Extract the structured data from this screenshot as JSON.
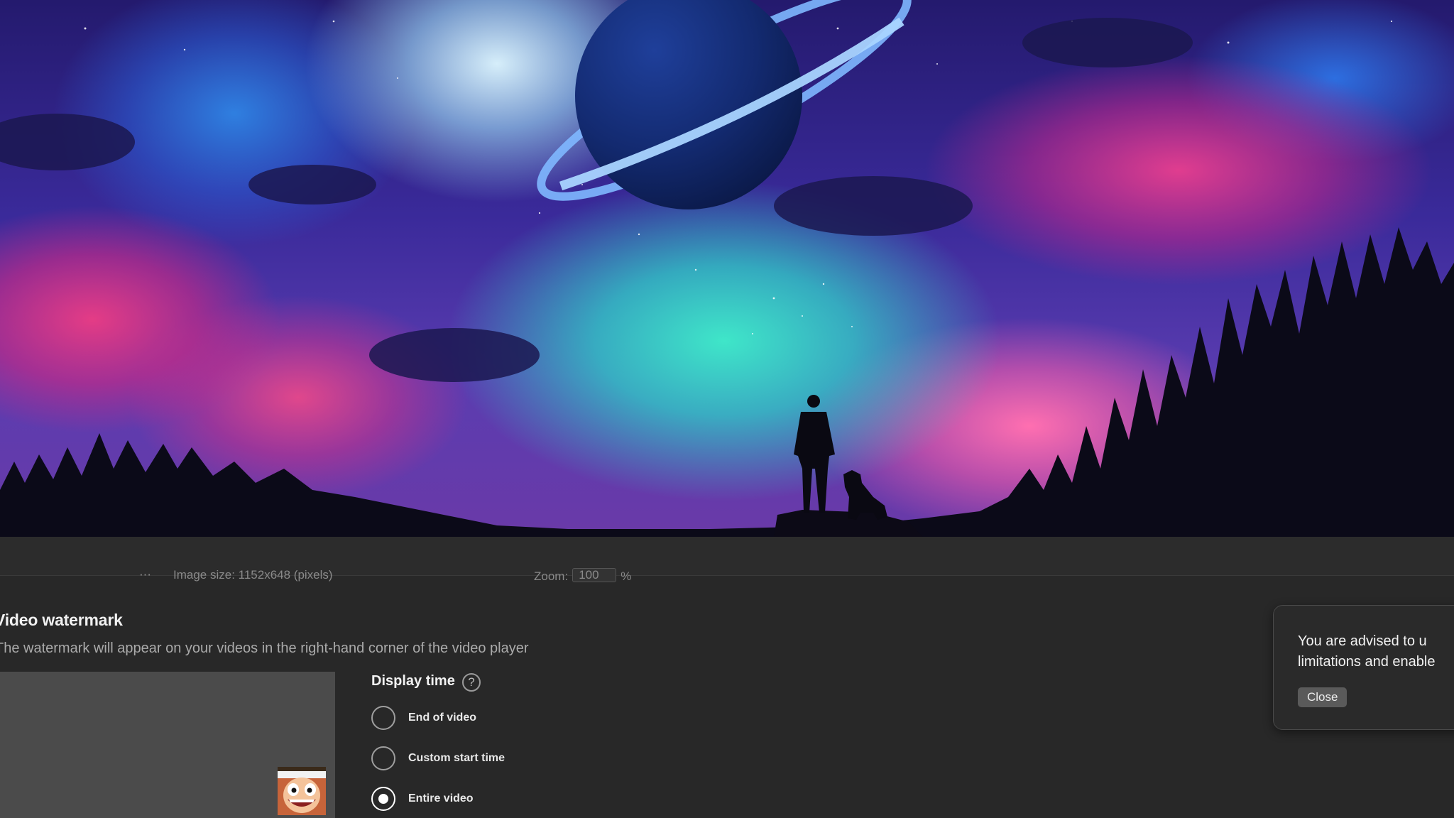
{
  "banner": {
    "image_size_text": "Image size: 1152x648 (pixels)",
    "zoom_label": "Zoom:",
    "zoom_value": "100",
    "zoom_unit": "%"
  },
  "watermark": {
    "title": "Video watermark",
    "description": "The watermark will appear on your videos in the right-hand corner of the video player",
    "display_time_label": "Display time",
    "help_glyph": "?",
    "options": [
      {
        "label": "End of video",
        "checked": false
      },
      {
        "label": "Custom start time",
        "checked": false
      },
      {
        "label": "Entire video",
        "checked": true
      }
    ]
  },
  "toast": {
    "message_line1": "You are advised to u",
    "message_line2": "limitations and enable",
    "close_label": "Close"
  }
}
